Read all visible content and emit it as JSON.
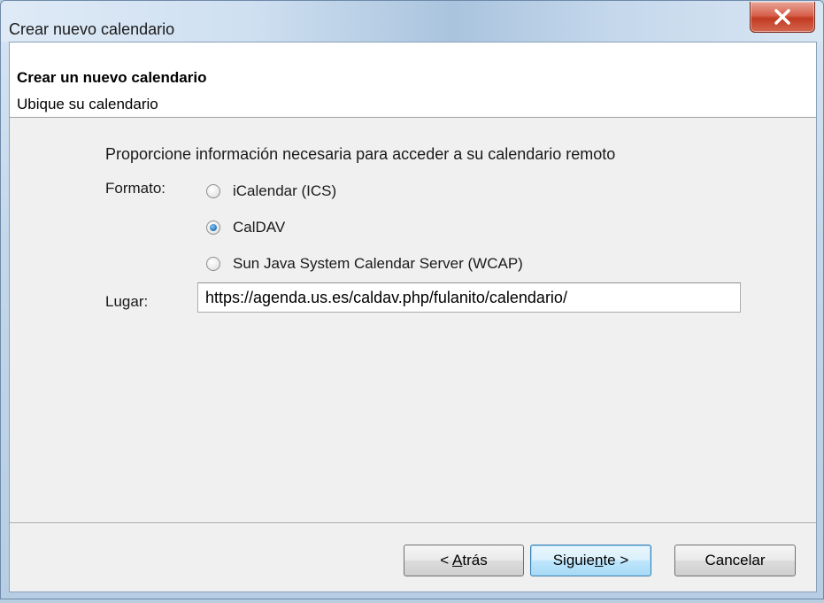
{
  "window": {
    "title": "Crear nuevo calendario",
    "close_icon": "close-x-icon"
  },
  "header": {
    "title": "Crear un nuevo calendario",
    "subtitle": "Ubique su calendario"
  },
  "form": {
    "intro": "Proporcione información necesaria para acceder a su calendario remoto",
    "format_label": "Formato:",
    "format_options": [
      {
        "label": "iCalendar (ICS)",
        "checked": false
      },
      {
        "label": "CalDAV",
        "checked": true
      },
      {
        "label": "Sun Java System Calendar Server (WCAP)",
        "checked": false
      }
    ],
    "place_label": "Lugar:",
    "place_value": "https://agenda.us.es/caldav.php/fulanito/calendario/"
  },
  "buttons": {
    "back": {
      "before": "< ",
      "mnemonic": "A",
      "after": "trás"
    },
    "next": {
      "before": "Siguie",
      "mnemonic": "n",
      "after": "te >"
    },
    "cancel": "Cancelar"
  },
  "colors": {
    "accent_radio": "#2a7fc6",
    "close_button": "#c23a22"
  }
}
